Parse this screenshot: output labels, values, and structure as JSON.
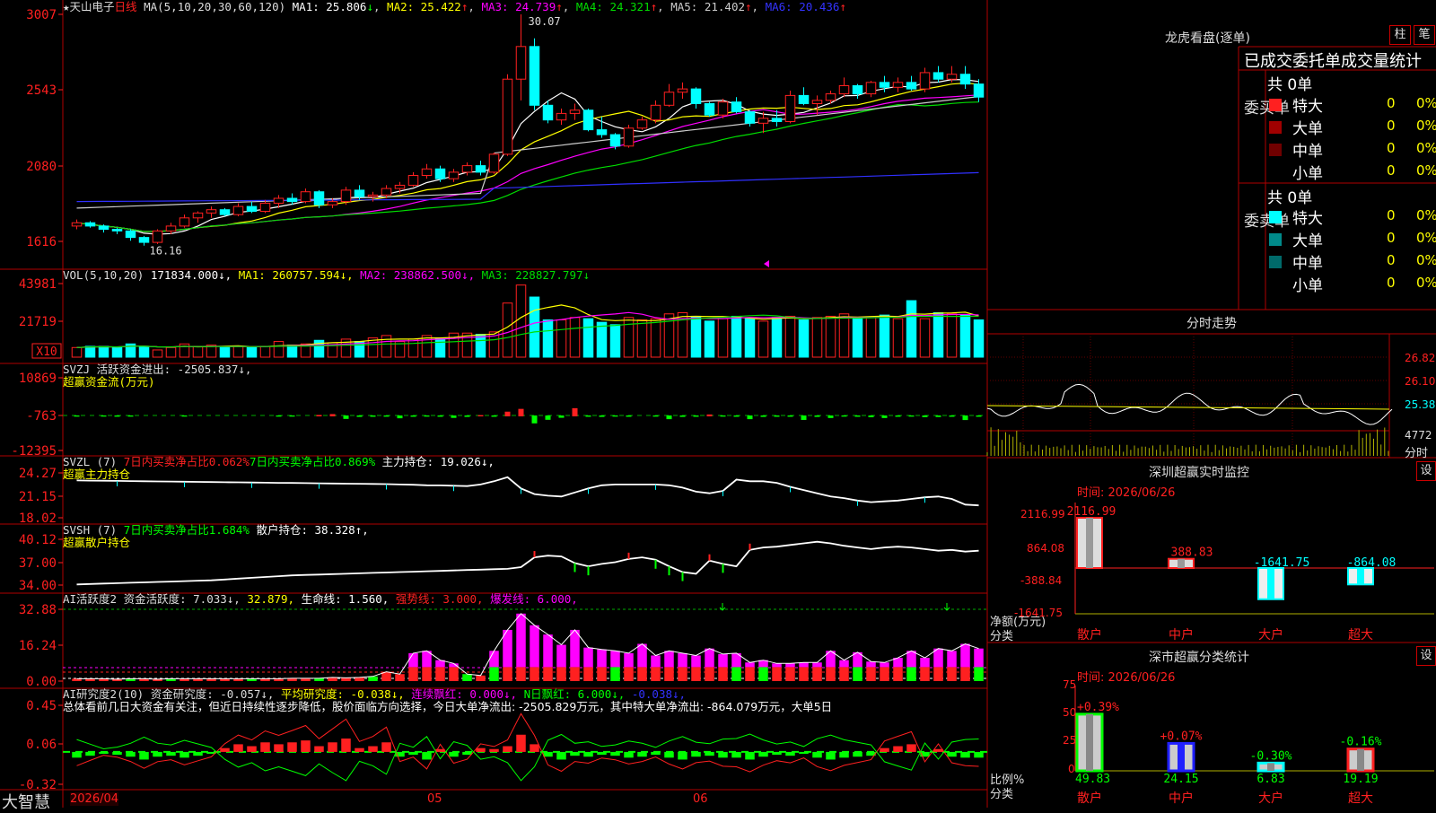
{
  "colors": {
    "up": "#ff2020",
    "down": "#00ffff",
    "frame": "#b00000",
    "ma1": "#ffffff",
    "ma2": "#ffff00",
    "ma3": "#ff00ff",
    "ma4": "#00dd00",
    "ma5": "#cccccc",
    "ma6": "#3030ff",
    "green": "#00ff00",
    "yellow": "#ffff00",
    "magenta": "#ff00ff",
    "grid": "#800000"
  },
  "header": {
    "stock_name": "★天山电子",
    "period": "日线",
    "ma_params": "MA(5,10,20,30,60,120)",
    "ma1": "MA1: 25.806",
    "ma2": "MA2: 25.422",
    "ma3": "MA3: 24.739",
    "ma4": "MA4: 24.321",
    "ma5": "MA5: 21.402",
    "ma6": "MA6: 20.436",
    "arrow_up": "↑",
    "arrow_down": "↓",
    "high_label": "30.07",
    "low_label": "16.16"
  },
  "axes": {
    "price": [
      "3007",
      "2543",
      "2080",
      "1616"
    ],
    "vol": [
      "43981",
      "21719",
      "X10"
    ],
    "svzj": [
      "10869",
      "-763",
      "-12395"
    ],
    "svzl": [
      "24.27",
      "21.15",
      "18.02"
    ],
    "svsh": [
      "40.12",
      "37.00",
      "34.00"
    ],
    "ai1": [
      "32.88",
      "16.24",
      "0.00"
    ],
    "ai2": [
      "0.45",
      "0.06",
      "-0.32"
    ]
  },
  "panels": {
    "vol": {
      "title": "VOL(5,10,20)",
      "v": "171834.000↓,",
      "ma1": "MA1: 260757.594↓,",
      "ma2": "MA2: 238862.500↓,",
      "ma3": "MA3: 228827.797↓"
    },
    "svzj": {
      "l1": "SVZJ  活跃资金进出: -2505.837↓,",
      "l2": "超赢资金流(万元)"
    },
    "svzl": {
      "a": "SVZL (7)",
      "b": "7日内买卖净占比0.062%",
      "c": "7日内买卖净占比0.869%",
      "d": "主力持仓: 19.026↓,",
      "l2": "超赢主力持仓"
    },
    "svsh": {
      "a": "SVSH (7)",
      "b": "7日内买卖净占比1.684%",
      "c": "散户持仓: 38.328↑,",
      "l2": "超赢散户持仓"
    },
    "ai1": {
      "a": "AI活跃度2 资金活跃度: 7.033↓,",
      "b": "32.879,",
      "c": "生命线: 1.560,",
      "d": "强势线: 3.000,",
      "e": "爆发线: 6.000,"
    },
    "ai2": {
      "a": "AI研究度2(10) 资金研究度: -0.057↓,",
      "b": "平均研究度: -0.038↓,",
      "c": "连续飘红: 0.000↓,",
      "d": "N日飘红: 6.000↓,",
      "e": "-0.038↓,",
      "desc": "总体看前几日大资金有关注，但近日持续性逐步降低，股价面临方向选择，今日大单净流出: -2505.829万元，其中特大单净流出: -864.079万元，大单5日"
    }
  },
  "footer": {
    "app": "大智慧",
    "d1": "2026/04",
    "d2": "05",
    "d3": "06"
  },
  "lhb": {
    "title": "龙虎看盘(逐单)",
    "btn1": "柱",
    "btn2": "笔",
    "subtitle": "已成交委托单成交量统计",
    "buy": {
      "label": "委买单",
      "total": "共 0单",
      "rows": [
        {
          "name": "特大",
          "n": "0",
          "p": "0%"
        },
        {
          "name": "大单",
          "n": "0",
          "p": "0%"
        },
        {
          "name": "中单",
          "n": "0",
          "p": "0%"
        },
        {
          "name": "小单",
          "n": "0",
          "p": "0%"
        }
      ]
    },
    "sell": {
      "label": "委卖单",
      "total": "共 0单",
      "rows": [
        {
          "name": "特大",
          "n": "0",
          "p": "0%"
        },
        {
          "name": "大单",
          "n": "0",
          "p": "0%"
        },
        {
          "name": "中单",
          "n": "0",
          "p": "0%"
        },
        {
          "name": "小单",
          "n": "0",
          "p": "0%"
        }
      ]
    }
  },
  "fs": {
    "title": "分时走势",
    "y": [
      "26.82",
      "26.10",
      "25.38",
      "4772",
      "分时"
    ]
  },
  "sz": {
    "title": "深圳超赢实时监控",
    "btn": "设",
    "time": "时间: 2026/06/26",
    "y": [
      "2116.99",
      "864.08",
      "-388.84",
      "-1641.75"
    ],
    "unit": "净额(万元)",
    "cls": "分类",
    "cats": [
      "散户",
      "中户",
      "大户",
      "超大"
    ],
    "values": [
      2116.99,
      388.83,
      -1641.75,
      -864.08
    ],
    "labels": [
      "2116.99",
      "388.83",
      "-1641.75",
      "-864.08"
    ]
  },
  "sc": {
    "title": "深市超赢分类统计",
    "btn": "设",
    "time": "时间: 2026/06/26",
    "y": [
      "75",
      "50",
      "25",
      "0"
    ],
    "unit": "比例%",
    "cls": "分类",
    "cats": [
      "散户",
      "中户",
      "大户",
      "超大"
    ],
    "values": [
      49.83,
      24.15,
      6.83,
      19.19
    ],
    "bottom": [
      "49.83",
      "24.15",
      "6.83",
      "19.19"
    ],
    "top": [
      "+0.39%",
      "+0.07%",
      "-0.30%",
      "-0.16%"
    ]
  },
  "chart_data": {
    "type": "candlestick",
    "candles": [
      [
        17.1,
        17.5,
        16.9,
        17.3
      ],
      [
        17.3,
        17.4,
        17.0,
        17.1
      ],
      [
        17.1,
        17.2,
        16.7,
        16.9
      ],
      [
        16.9,
        17.0,
        16.6,
        16.8
      ],
      [
        16.8,
        16.9,
        16.2,
        16.4
      ],
      [
        16.4,
        16.5,
        15.9,
        16.1
      ],
      [
        16.1,
        16.9,
        16.0,
        16.8
      ],
      [
        16.8,
        17.3,
        16.6,
        17.1
      ],
      [
        17.1,
        17.8,
        17.0,
        17.6
      ],
      [
        17.6,
        18.0,
        17.3,
        17.9
      ],
      [
        17.9,
        18.3,
        17.6,
        18.1
      ],
      [
        18.1,
        18.2,
        17.7,
        17.8
      ],
      [
        17.8,
        18.5,
        17.7,
        18.3
      ],
      [
        18.3,
        18.6,
        17.9,
        18.0
      ],
      [
        18.0,
        18.7,
        17.9,
        18.5
      ],
      [
        18.5,
        19.0,
        18.2,
        18.8
      ],
      [
        18.8,
        19.1,
        18.4,
        18.6
      ],
      [
        18.6,
        19.4,
        18.5,
        19.2
      ],
      [
        19.2,
        19.3,
        18.2,
        18.4
      ],
      [
        18.4,
        18.8,
        18.2,
        18.6
      ],
      [
        18.6,
        19.5,
        18.4,
        19.3
      ],
      [
        19.3,
        19.6,
        18.7,
        18.9
      ],
      [
        18.9,
        19.2,
        18.6,
        19.0
      ],
      [
        19.0,
        19.6,
        18.8,
        19.4
      ],
      [
        19.4,
        19.8,
        19.1,
        19.6
      ],
      [
        19.6,
        20.4,
        19.5,
        20.2
      ],
      [
        20.2,
        20.9,
        20.0,
        20.6
      ],
      [
        20.6,
        20.8,
        19.8,
        20.0
      ],
      [
        20.0,
        20.6,
        19.8,
        20.4
      ],
      [
        20.4,
        21.0,
        20.2,
        20.8
      ],
      [
        20.8,
        21.1,
        20.2,
        20.4
      ],
      [
        20.4,
        21.6,
        20.3,
        21.5
      ],
      [
        21.5,
        26.4,
        21.4,
        26.1
      ],
      [
        26.1,
        30.07,
        24.8,
        28.1
      ],
      [
        28.1,
        28.6,
        24.2,
        24.5
      ],
      [
        24.5,
        24.8,
        23.4,
        23.6
      ],
      [
        23.6,
        24.3,
        23.3,
        24.0
      ],
      [
        24.0,
        24.6,
        23.6,
        24.2
      ],
      [
        24.2,
        24.3,
        22.9,
        23.0
      ],
      [
        23.0,
        23.8,
        22.5,
        22.7
      ],
      [
        22.7,
        22.8,
        21.8,
        22.0
      ],
      [
        22.0,
        23.3,
        21.9,
        23.1
      ],
      [
        23.1,
        23.8,
        23.0,
        23.6
      ],
      [
        23.6,
        24.8,
        23.4,
        24.5
      ],
      [
        24.5,
        25.8,
        24.4,
        25.3
      ],
      [
        25.3,
        25.9,
        24.9,
        25.5
      ],
      [
        25.5,
        25.6,
        24.3,
        24.6
      ],
      [
        24.6,
        24.7,
        23.8,
        23.9
      ],
      [
        23.9,
        24.9,
        23.7,
        24.7
      ],
      [
        24.7,
        25.0,
        24.0,
        24.1
      ],
      [
        24.1,
        24.2,
        23.2,
        23.4
      ],
      [
        23.4,
        24.1,
        22.8,
        23.7
      ],
      [
        23.7,
        24.2,
        23.2,
        23.5
      ],
      [
        23.5,
        25.4,
        23.4,
        25.1
      ],
      [
        25.1,
        25.6,
        24.5,
        24.6
      ],
      [
        24.6,
        25.1,
        23.9,
        24.8
      ],
      [
        24.8,
        25.4,
        24.6,
        25.2
      ],
      [
        25.2,
        26.2,
        25.0,
        25.7
      ],
      [
        25.7,
        25.8,
        24.9,
        25.2
      ],
      [
        25.2,
        26.0,
        25.0,
        25.9
      ],
      [
        25.9,
        26.3,
        25.3,
        25.6
      ],
      [
        25.6,
        26.2,
        25.3,
        25.9
      ],
      [
        25.9,
        26.3,
        25.4,
        25.5
      ],
      [
        25.5,
        26.8,
        25.3,
        26.5
      ],
      [
        26.5,
        26.9,
        25.9,
        26.1
      ],
      [
        26.1,
        26.9,
        25.9,
        26.4
      ],
      [
        26.4,
        26.9,
        25.5,
        25.8
      ],
      [
        25.8,
        26.1,
        24.7,
        25.0
      ]
    ],
    "volume": [
      0.8,
      0.9,
      0.9,
      0.8,
      1.1,
      0.9,
      0.6,
      0.8,
      1.1,
      0.9,
      1.0,
      0.8,
      0.9,
      0.8,
      0.9,
      1.3,
      1.0,
      1.1,
      1.4,
      1.2,
      1.5,
      1.3,
      1.6,
      1.8,
      1.3,
      1.5,
      1.8,
      1.6,
      2.0,
      2.0,
      1.9,
      2.1,
      4.5,
      6.0,
      5.0,
      3.1,
      3.1,
      3.3,
      3.2,
      2.9,
      2.7,
      3.3,
      3.1,
      3.2,
      3.6,
      3.7,
      3.4,
      3.0,
      3.2,
      3.4,
      3.2,
      3.0,
      3.3,
      3.4,
      3.1,
      3.3,
      3.4,
      3.6,
      3.3,
      3.3,
      3.5,
      3.2,
      4.7,
      3.2,
      3.7,
      3.6,
      3.5,
      3.1
    ],
    "svzj": [
      -200,
      -150,
      -180,
      -250,
      -200,
      -150,
      -100,
      -120,
      -180,
      -130,
      -160,
      -140,
      -120,
      -160,
      -150,
      -200,
      -180,
      -170,
      300,
      800,
      -2000,
      -400,
      -300,
      -250,
      -1500,
      -300,
      -200,
      -300,
      -1200,
      -400,
      200,
      -300,
      2200,
      3800,
      -5500,
      -2700,
      -1100,
      4200,
      -300,
      -400,
      -200,
      -300,
      -150,
      -200,
      -2200,
      -400,
      -300,
      600,
      -200,
      -300,
      -2200,
      -400,
      -300,
      -300,
      -2800,
      -400,
      -1300,
      -200,
      -300,
      -700,
      -1300,
      -300,
      -200,
      -600,
      -500,
      -300,
      -2900,
      -300
    ],
    "svzl": [
      23.0,
      22.98,
      22.96,
      22.94,
      22.92,
      22.9,
      22.88,
      22.86,
      22.84,
      22.82,
      22.8,
      22.78,
      22.76,
      22.74,
      22.72,
      22.7,
      22.68,
      22.66,
      22.64,
      22.62,
      22.6,
      22.58,
      22.56,
      22.54,
      22.5,
      22.46,
      22.4,
      22.38,
      22.34,
      22.3,
      22.5,
      22.9,
      23.4,
      22.0,
      21.3,
      21.1,
      21.0,
      21.5,
      22.0,
      22.4,
      22.5,
      22.5,
      22.5,
      22.5,
      22.4,
      22.1,
      21.6,
      21.4,
      21.7,
      23.1,
      22.9,
      22.9,
      22.7,
      22.2,
      21.8,
      21.4,
      21.0,
      20.8,
      20.5,
      20.3,
      20.4,
      20.5,
      20.7,
      20.9,
      21.0,
      20.7,
      20.0,
      19.9
    ],
    "svsh": [
      34.3,
      34.35,
      34.4,
      34.45,
      34.5,
      34.55,
      34.6,
      34.65,
      34.7,
      34.75,
      34.8,
      34.9,
      35.0,
      35.1,
      35.2,
      35.3,
      35.4,
      35.45,
      35.5,
      35.55,
      35.6,
      35.65,
      35.7,
      35.75,
      35.8,
      35.85,
      35.9,
      35.95,
      36.0,
      36.05,
      36.1,
      36.15,
      36.2,
      36.4,
      37.6,
      37.8,
      37.7,
      36.9,
      36.5,
      36.8,
      37.0,
      37.4,
      37.6,
      37.3,
      36.5,
      35.8,
      35.6,
      37.2,
      36.8,
      36.5,
      38.5,
      38.8,
      38.9,
      39.1,
      39.3,
      39.5,
      39.3,
      39.0,
      38.8,
      38.6,
      38.8,
      38.9,
      38.8,
      38.6,
      38.4,
      38.5,
      38.3,
      38.4
    ],
    "ai1": [
      0.5,
      0.5,
      0.5,
      0.4,
      0.5,
      0.5,
      0.4,
      0.5,
      0.5,
      0.5,
      0.5,
      0.5,
      0.5,
      0.5,
      0.5,
      0.5,
      0.6,
      0.6,
      0.6,
      0.8,
      0.7,
      0.8,
      1.0,
      2.0,
      1.5,
      6.0,
      6.5,
      4.5,
      3.8,
      1.5,
      1.2,
      6.5,
      11.0,
      14.5,
      12.0,
      10.0,
      7.8,
      11.0,
      7.2,
      6.8,
      6.5,
      6.0,
      8.0,
      5.5,
      6.5,
      6.0,
      5.5,
      7.0,
      5.8,
      6.0,
      4.0,
      4.5,
      3.8,
      3.8,
      4.0,
      4.0,
      6.5,
      4.5,
      6.2,
      4.2,
      4.0,
      5.0,
      6.5,
      5.0,
      7.0,
      6.5,
      8.0,
      7.0,
      6.8,
      7.0
    ],
    "ai2": [
      -0.06,
      -0.04,
      -0.02,
      -0.03,
      -0.05,
      -0.08,
      -0.05,
      -0.04,
      -0.06,
      -0.04,
      -0.02,
      0.04,
      0.08,
      0.06,
      0.1,
      0.08,
      0.1,
      0.12,
      0.06,
      0.1,
      0.14,
      0.04,
      0.06,
      0.1,
      -0.05,
      -0.03,
      -0.08,
      0.03,
      -0.05,
      -0.03,
      0.04,
      0.03,
      0.06,
      0.18,
      0.08,
      -0.05,
      -0.08,
      -0.04,
      -0.05,
      -0.03,
      -0.04,
      -0.06,
      -0.05,
      -0.03,
      -0.06,
      -0.08,
      -0.05,
      -0.04,
      -0.06,
      -0.06,
      -0.08,
      -0.05,
      -0.03,
      -0.04,
      -0.02,
      -0.06,
      -0.08,
      -0.06,
      -0.05,
      -0.04,
      0.04,
      0.06,
      0.08,
      -0.05,
      0.03,
      -0.05,
      -0.06,
      -0.06
    ]
  }
}
